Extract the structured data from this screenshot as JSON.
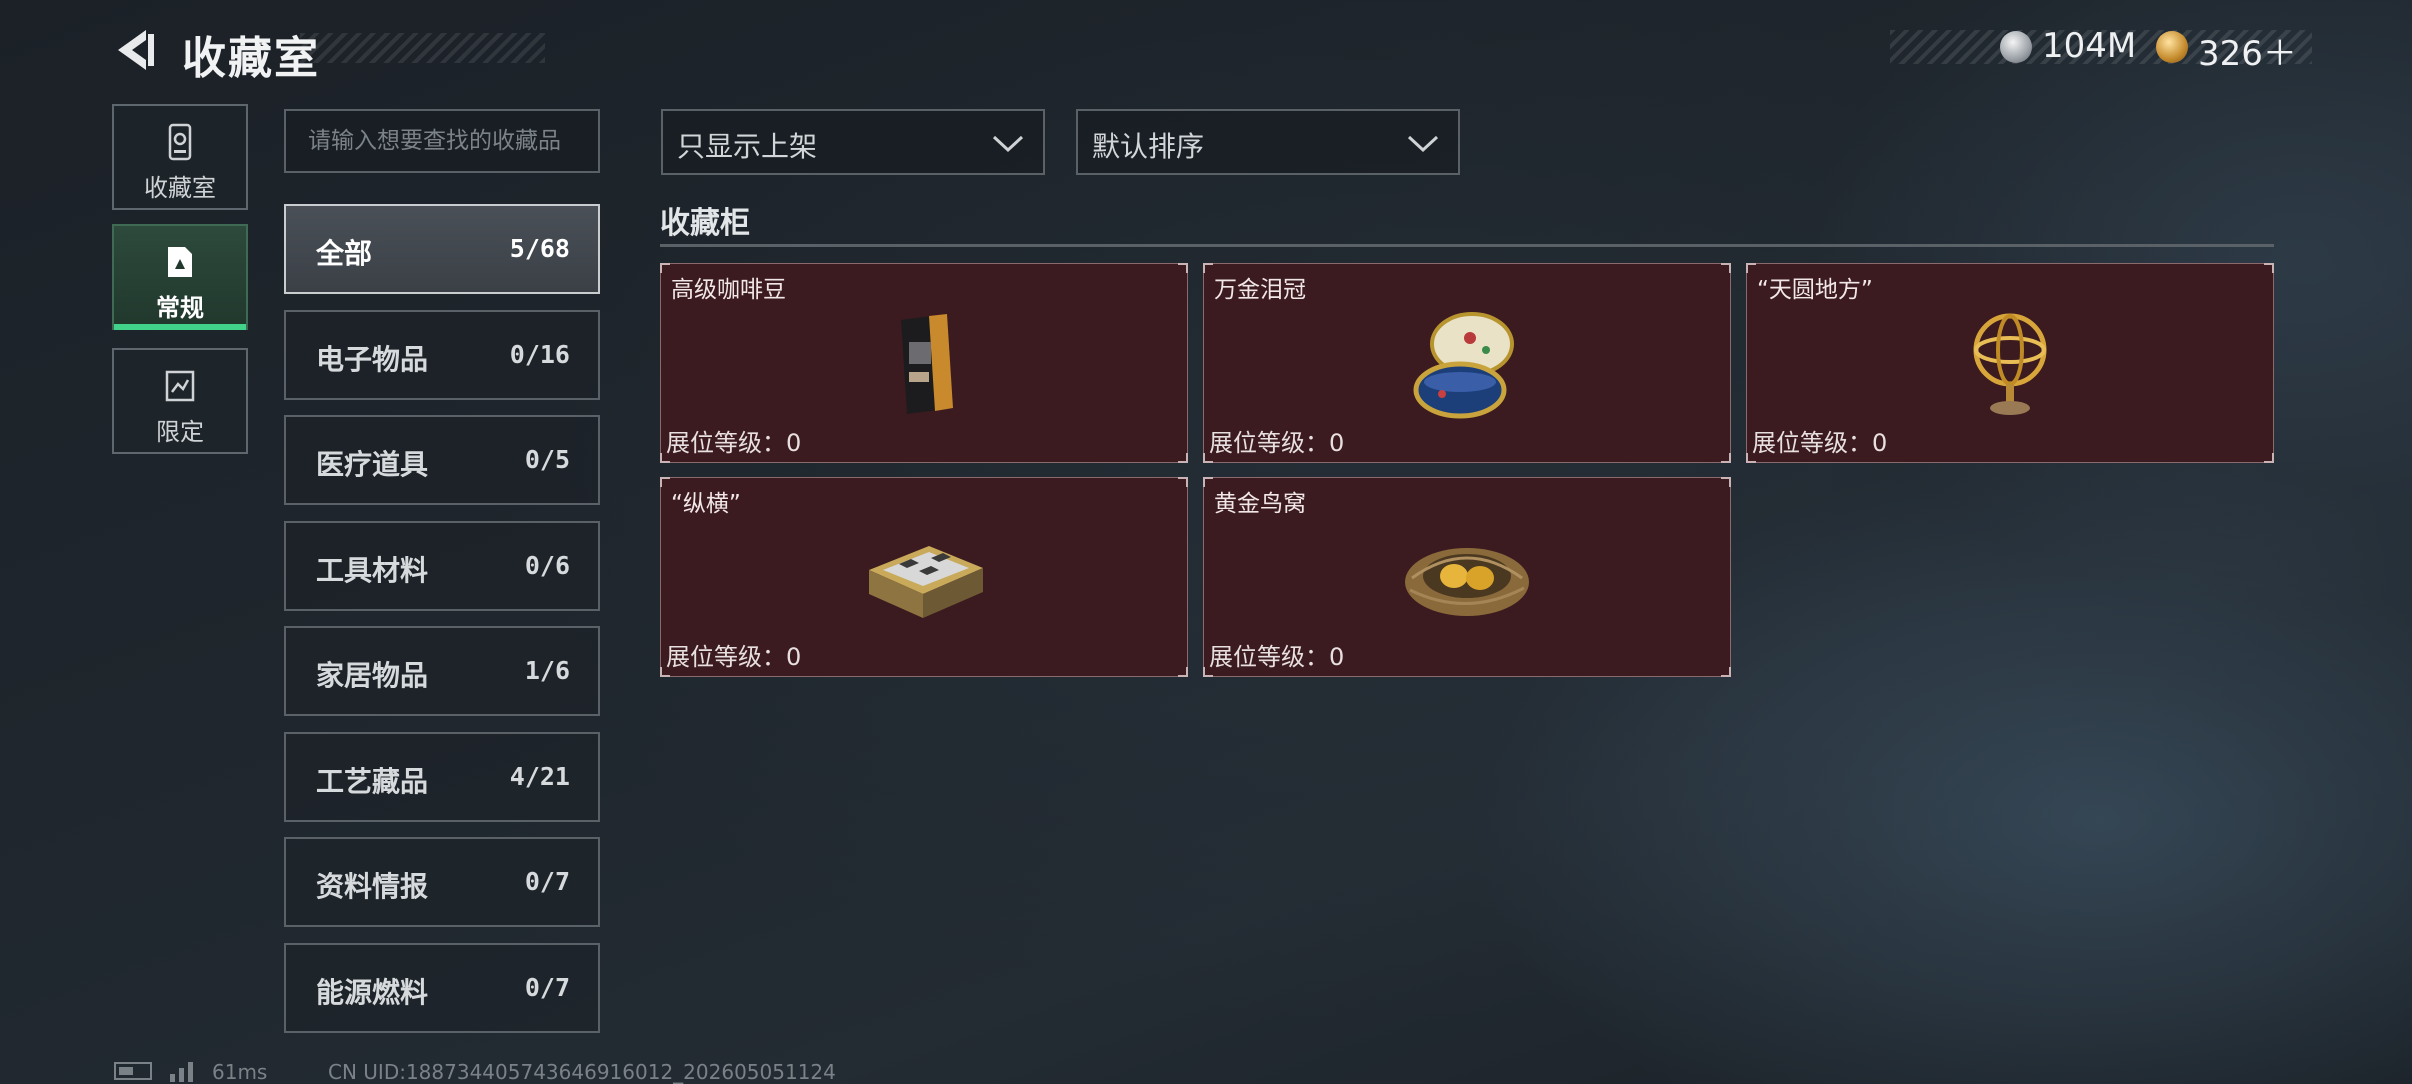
{
  "header": {
    "title": "收藏室",
    "currency": [
      {
        "icon": "silver-coin-icon",
        "value": "104M"
      },
      {
        "icon": "gold-coin-icon",
        "value": "326＋"
      }
    ]
  },
  "mode_tabs": [
    {
      "icon": "collection-room-icon",
      "label": "收藏室",
      "active": false
    },
    {
      "icon": "regular-icon",
      "label": "常规",
      "active": true
    },
    {
      "icon": "limited-icon",
      "label": "限定",
      "active": false
    }
  ],
  "search": {
    "placeholder": "请输入想要查找的收藏品",
    "value": ""
  },
  "categories": [
    {
      "name": "全部",
      "count": "5/68",
      "active": true
    },
    {
      "name": "电子物品",
      "count": "0/16"
    },
    {
      "name": "医疗道具",
      "count": "0/5"
    },
    {
      "name": "工具材料",
      "count": "0/6"
    },
    {
      "name": "家居物品",
      "count": "1/6"
    },
    {
      "name": "工艺藏品",
      "count": "4/21"
    },
    {
      "name": "资料情报",
      "count": "0/7"
    },
    {
      "name": "能源燃料",
      "count": "0/7"
    }
  ],
  "filters": {
    "display_filter": "只显示上架",
    "sort": "默认排序"
  },
  "section": {
    "title": "收藏柜"
  },
  "items": [
    {
      "name": "高级咖啡豆",
      "level_label": "展位等级：",
      "level": "0",
      "icon": "coffee-bag-icon"
    },
    {
      "name": "万金泪冠",
      "level_label": "展位等级：",
      "level": "0",
      "icon": "jeweled-egg-icon"
    },
    {
      "name": "“天圆地方”",
      "level_label": "展位等级：",
      "level": "0",
      "icon": "armillary-sphere-icon"
    },
    {
      "name": "“纵横”",
      "level_label": "展位等级：",
      "level": "0",
      "icon": "chess-box-icon"
    },
    {
      "name": "黄金鸟窝",
      "level_label": "展位等级：",
      "level": "0",
      "icon": "golden-nest-icon"
    }
  ],
  "footer": {
    "ping": "61ms",
    "uid": "CN UID:1887344057436469160​12_202605051124"
  },
  "colors": {
    "accent_green": "#41d38a",
    "card_bg": "#3b1b1f"
  }
}
